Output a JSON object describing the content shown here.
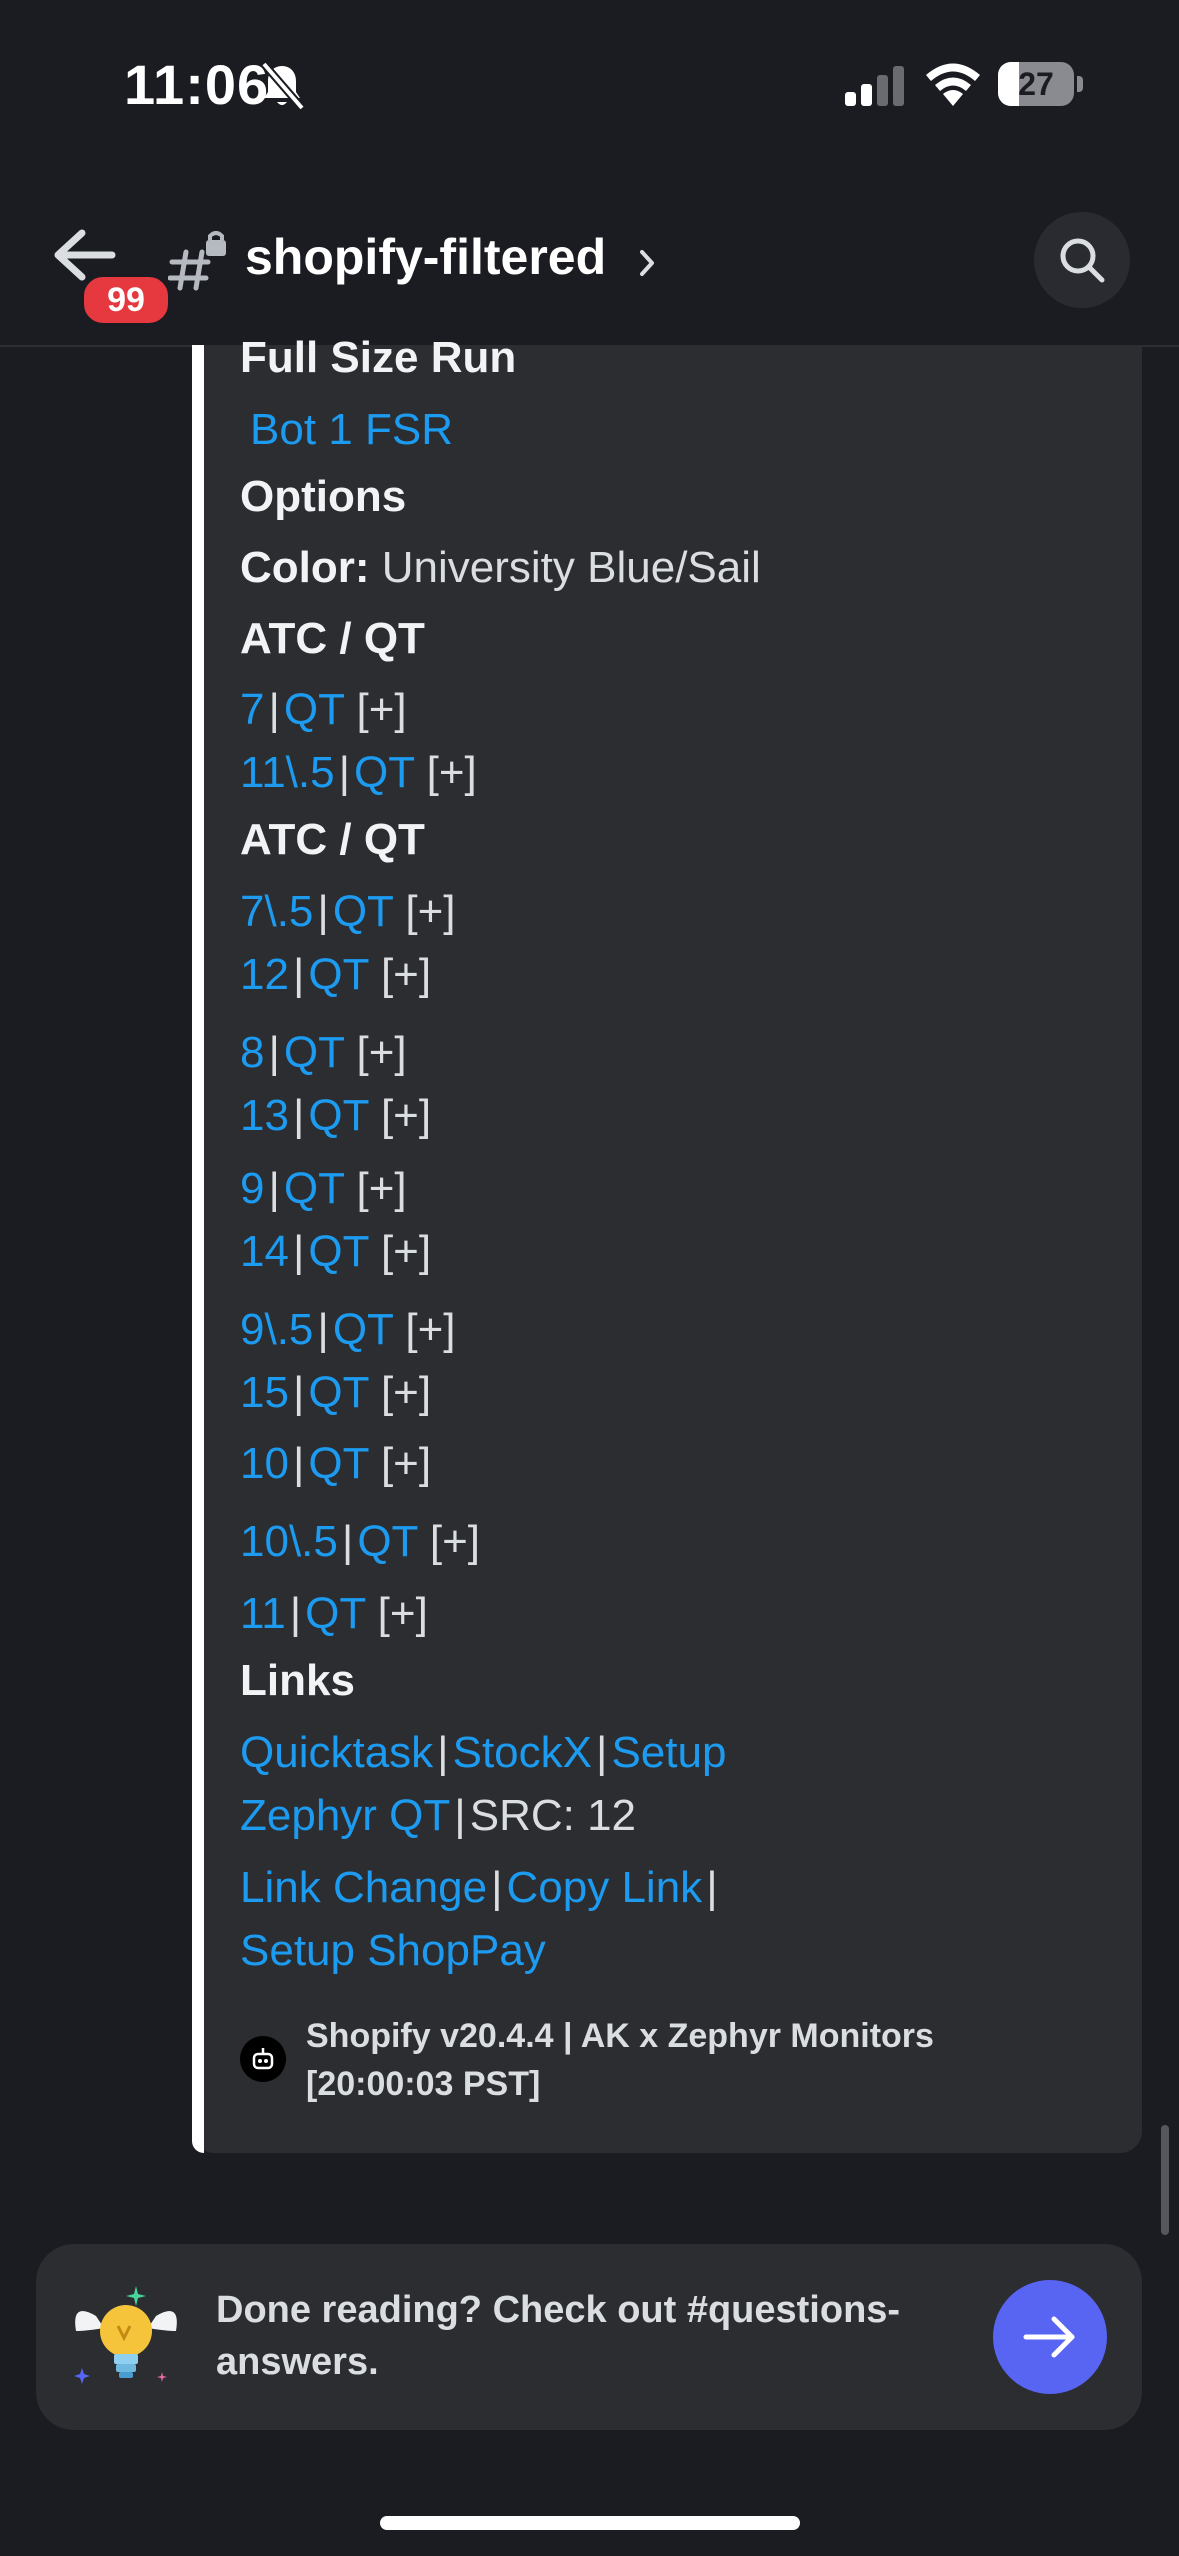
{
  "status_bar": {
    "time": "11:06",
    "battery": "27",
    "battery_level": 0.27
  },
  "header": {
    "badge": "99",
    "channel": "shopify-filtered"
  },
  "embed": {
    "full_size_run_label": "Full Size Run",
    "fsr_link": "Bot 1 FSR",
    "options_label": "Options",
    "color_label": "Color:",
    "color_value": "University Blue/Sail",
    "atc_label": "ATC / QT",
    "sep": "|",
    "qt": "QT",
    "plus": "[+]",
    "sizes": [
      "7",
      "11\\.5",
      "7\\.5",
      "12",
      "8",
      "13",
      "9",
      "14",
      "9\\.5",
      "15",
      "10",
      "10\\.5",
      "11"
    ],
    "links_label": "Links",
    "links": {
      "quicktask": "Quicktask",
      "stockx": "StockX",
      "setup": "Setup",
      "zephyr_qt": "Zephyr QT",
      "src": "SRC: 12",
      "link_change": "Link Change",
      "copy_link": "Copy Link",
      "setup_shoppay": "Setup ShopPay"
    },
    "footer_line1": "Shopify v20.4.4 | AK x Zephyr Monitors",
    "footer_line2": "[20:00:03 PST]"
  },
  "prompt": {
    "line1": "Done reading? Check out #questions-",
    "line2": "answers."
  },
  "colors": {
    "link": "#1c9bf0",
    "accent": "#5865f2",
    "badge": "#e5393f",
    "background": "#1b1c21",
    "embed": "#2b2d31"
  },
  "icons": [
    "bell-slash-icon",
    "cellular-signal-icon",
    "wifi-icon",
    "battery-icon",
    "back-arrow-icon",
    "channel-hash-lock-icon",
    "chevron-right-icon",
    "search-icon",
    "bot-avatar-icon",
    "lightbulb-wings-icon",
    "arrow-right-icon"
  ]
}
